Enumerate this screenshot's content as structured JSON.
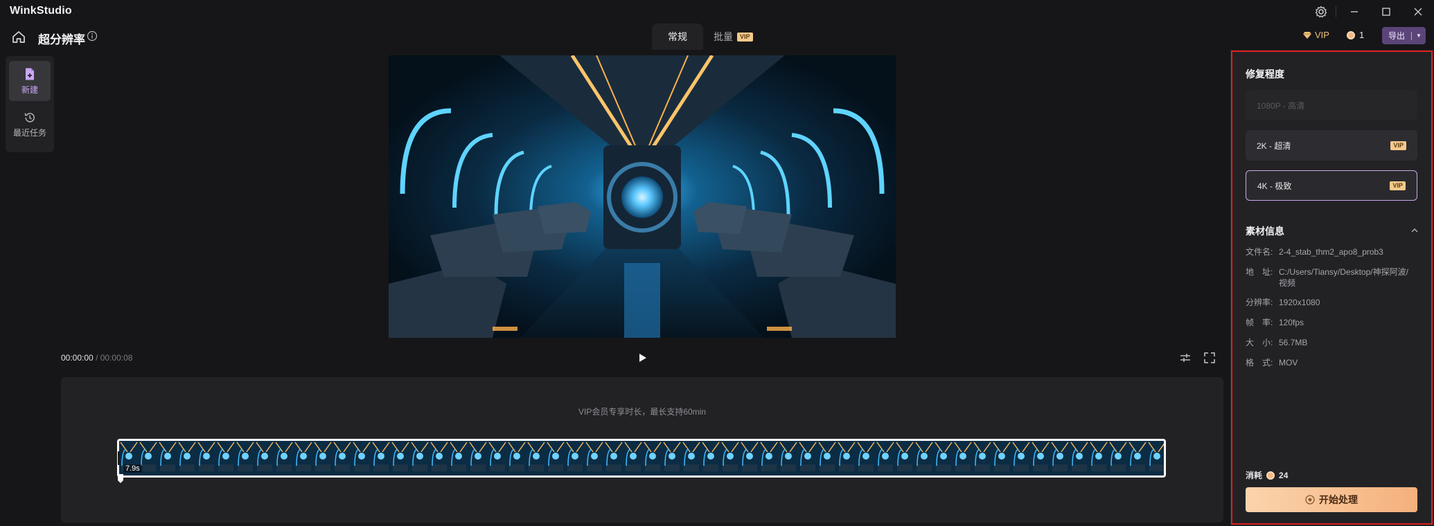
{
  "app": {
    "title": "WinkStudio"
  },
  "toolbar": {
    "page_title": "超分辨率",
    "tabs": [
      {
        "label": "常规",
        "active": true
      },
      {
        "label": "批量",
        "badge": "VIP"
      }
    ],
    "vip_label": "VIP",
    "coin_count": "1",
    "export_label": "导出"
  },
  "left_nav": {
    "items": [
      {
        "label": "新建",
        "icon": "new-file-icon",
        "active": true
      },
      {
        "label": "最近任务",
        "icon": "history-icon"
      }
    ]
  },
  "player": {
    "current_time": "00:00:00",
    "separator": "/",
    "total_time": "00:00:08"
  },
  "timeline": {
    "vip_hint": "VIP会员专享时长，最长支持60min",
    "clip_duration": "7.9s"
  },
  "panel": {
    "restore_title": "修复程度",
    "options": [
      {
        "label": "1080P - 高清",
        "disabled": true
      },
      {
        "label": "2K - 超清",
        "badge": "VIP"
      },
      {
        "label": "4K - 极致",
        "badge": "VIP",
        "selected": true
      }
    ],
    "info_title": "素材信息",
    "info": [
      {
        "key": "文件名:",
        "value": "2-4_stab_thm2_apo8_prob3"
      },
      {
        "key": "地　址:",
        "value": "C:/Users/Tiansy/Desktop/神探阿波/视频"
      },
      {
        "key": "分辨率:",
        "value": "1920x1080"
      },
      {
        "key": "帧　率:",
        "value": "120fps"
      },
      {
        "key": "大　小:",
        "value": "56.7MB"
      },
      {
        "key": "格　式:",
        "value": "MOV"
      }
    ],
    "cost_label": "消耗",
    "cost_value": "24",
    "start_label": "开始处理"
  },
  "colors": {
    "accent_vip": "#f4c98b",
    "export_bg": "#5b4478",
    "selection_border": "#c9a8e8",
    "highlight_frame": "#e0201f"
  }
}
